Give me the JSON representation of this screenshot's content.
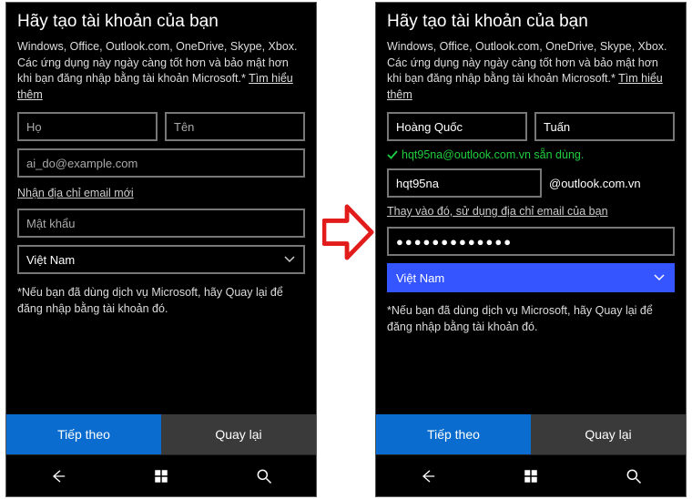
{
  "shared": {
    "title": "Hãy tạo tài khoản của bạn",
    "description": "Windows, Office, Outlook.com, OneDrive, Skype, Xbox. Các ứng dụng này ngày càng tốt hơn và bảo mật hơn khi bạn đăng nhập bằng tài khoản Microsoft.* ",
    "learn_more": "Tìm hiểu thêm",
    "note": "*Nếu bạn đã dùng dịch vụ Microsoft, hãy Quay lại để đăng nhập bằng tài khoản đó.",
    "btn_next": "Tiếp theo",
    "btn_back": "Quay lại"
  },
  "left": {
    "last_name_ph": "Họ",
    "first_name_ph": "Tên",
    "email_ph": "ai_do@example.com",
    "get_new_email": "Nhận địa chỉ email mới",
    "password_ph": "Mật khẩu",
    "country": "Việt Nam"
  },
  "right": {
    "last_name": "Hoàng Quốc",
    "first_name": "Tuấn",
    "avail_text": "hqt95na@outlook.com.vn sẵn dùng.",
    "alias": "hqt95na",
    "domain": "@outlook.com.vn",
    "use_own_email": "Thay vào đó, sử dụng địa chỉ email của bạn",
    "password_mask": "●●●●●●●●●●●●●",
    "country": "Việt Nam"
  },
  "icons": {
    "back": "back-icon",
    "windows": "windows-icon",
    "search": "search-icon",
    "chevron": "chevron-down-icon",
    "check": "check-icon",
    "arrow": "arrow-right-icon"
  }
}
